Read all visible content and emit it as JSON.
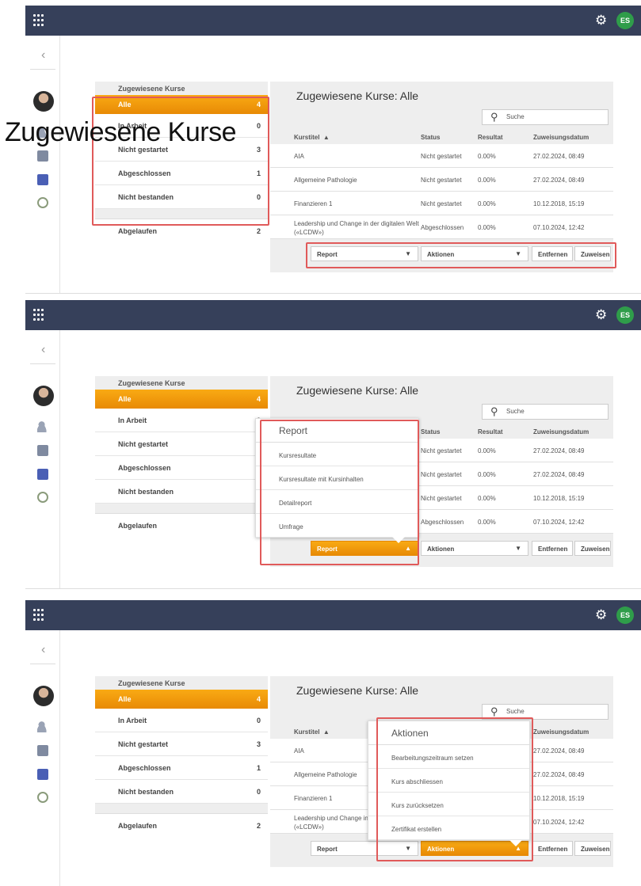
{
  "overlay_text": "Zugewiesene Kurse",
  "topbar": {
    "user_initials": "ES"
  },
  "left_panel": {
    "header": "Zugewiesene Kurse",
    "items": [
      {
        "label": "Alle",
        "count": "4"
      },
      {
        "label": "In Arbeit",
        "count": "0"
      },
      {
        "label": "Nicht gestartet",
        "count": "3"
      },
      {
        "label": "Abgeschlossen",
        "count": "1"
      },
      {
        "label": "Nicht bestanden",
        "count": "0"
      }
    ],
    "expired": {
      "label": "Abgelaufen",
      "count": "2"
    }
  },
  "right_panel": {
    "title": "Zugewiesene Kurse: Alle",
    "search_placeholder": "Suche",
    "columns": {
      "title": "Kurstitel",
      "sort_indicator": "▲",
      "status": "Status",
      "result": "Resultat",
      "date": "Zuweisungsdatum"
    },
    "rows": [
      {
        "title": "AIA",
        "status": "Nicht gestartet",
        "result": "0.00%",
        "date": "27.02.2024, 08:49"
      },
      {
        "title": "Allgemeine Pathologie",
        "status": "Nicht gestartet",
        "result": "0.00%",
        "date": "27.02.2024, 08:49"
      },
      {
        "title": "Finanzieren 1",
        "status": "Nicht gestartet",
        "result": "0.00%",
        "date": "10.12.2018, 15:19"
      },
      {
        "title": "Leadership und Change in der digitalen Welt («LCDW»)",
        "status": "Abgeschlossen",
        "result": "0.00%",
        "date": "07.10.2024, 12:42"
      }
    ],
    "buttons": {
      "report": "Report",
      "actions": "Aktionen",
      "remove": "Entfernen",
      "assign": "Zuweisen",
      "down_arrow": "▼",
      "up_arrow": "▲"
    }
  },
  "report_menu": {
    "title": "Report",
    "items": [
      "Kursresultate",
      "Kursresultate mit Kursinhalten",
      "Detailreport",
      "Umfrage"
    ]
  },
  "actions_menu": {
    "title": "Aktionen",
    "items": [
      "Bearbeitungszeitraum setzen",
      "Kurs abschliessen",
      "Kurs zurücksetzen",
      "Zertifikat erstellen"
    ]
  },
  "colors": {
    "topbar": "#36405a",
    "accent": "#f39c0e",
    "highlight": "#e05a5a",
    "badge": "#2f9d4a"
  }
}
